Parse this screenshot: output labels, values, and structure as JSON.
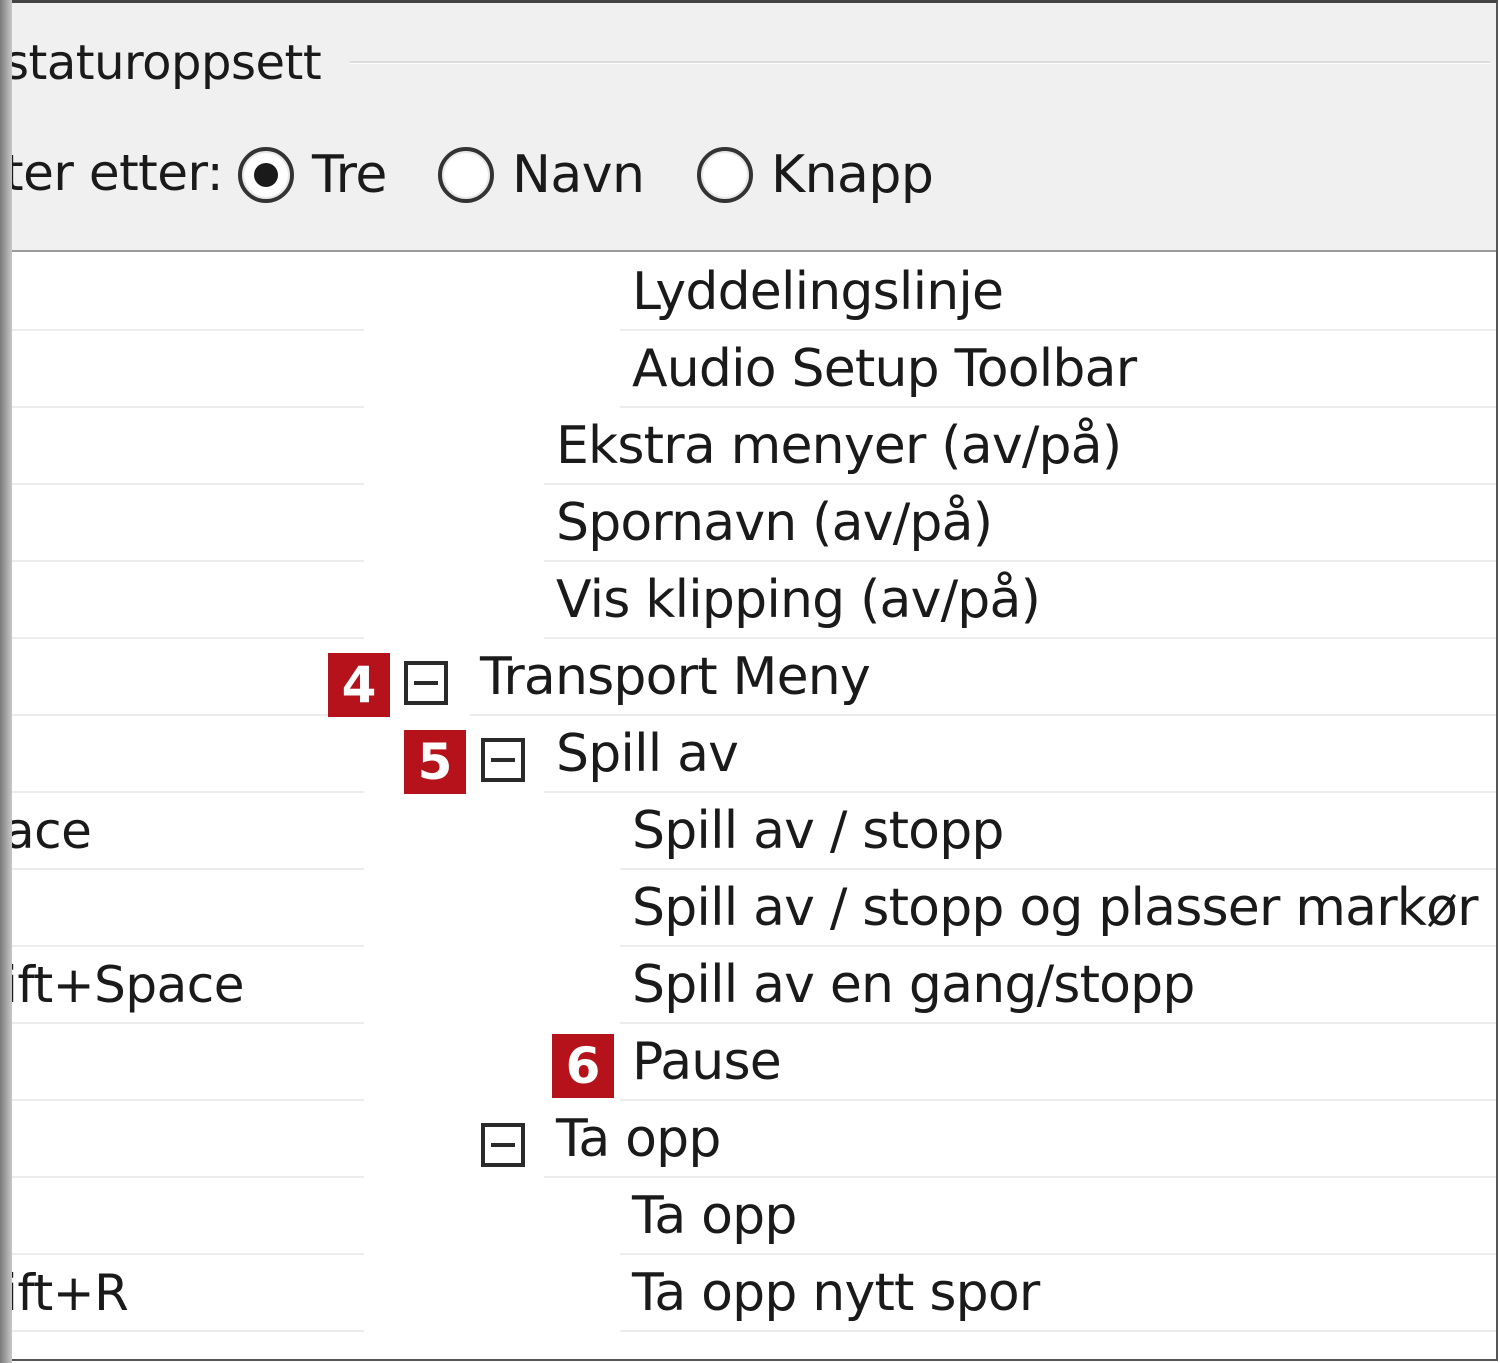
{
  "header": {
    "group_title": "staturoppsett",
    "filter_label": "ter etter:",
    "radios": [
      {
        "label": "Tre",
        "selected": true
      },
      {
        "label": "Navn",
        "selected": false
      },
      {
        "label": "Knapp",
        "selected": false
      }
    ]
  },
  "rows": [
    {
      "key": "",
      "label": "Lyddelingslinje",
      "toggle": false,
      "badge": ""
    },
    {
      "key": "",
      "label": "Audio Setup Toolbar",
      "toggle": false,
      "badge": ""
    },
    {
      "key": "",
      "label": "Ekstra menyer (av/på)",
      "toggle": false,
      "badge": ""
    },
    {
      "key": "",
      "label": "Spornavn (av/på)",
      "toggle": false,
      "badge": ""
    },
    {
      "key": "",
      "label": "Vis klipping (av/på)",
      "toggle": false,
      "badge": ""
    },
    {
      "key": "",
      "label": "Transport Meny",
      "toggle": true,
      "badge": "4"
    },
    {
      "key": "",
      "label": "Spill av",
      "toggle": true,
      "badge": "5"
    },
    {
      "key": "ace",
      "label": "Spill av / stopp",
      "toggle": false,
      "badge": ""
    },
    {
      "key": "",
      "label": "Spill av / stopp og plasser markør",
      "toggle": false,
      "badge": ""
    },
    {
      "key": "ift+Space",
      "label": "Spill av en gang/stopp",
      "toggle": false,
      "badge": ""
    },
    {
      "key": "",
      "label": "Pause",
      "toggle": false,
      "badge": "6"
    },
    {
      "key": "",
      "label": "Ta opp",
      "toggle": true,
      "badge": ""
    },
    {
      "key": "",
      "label": "Ta opp",
      "toggle": false,
      "badge": ""
    },
    {
      "key": "ift+R",
      "label": "Ta opp nytt spor",
      "toggle": false,
      "badge": ""
    }
  ]
}
